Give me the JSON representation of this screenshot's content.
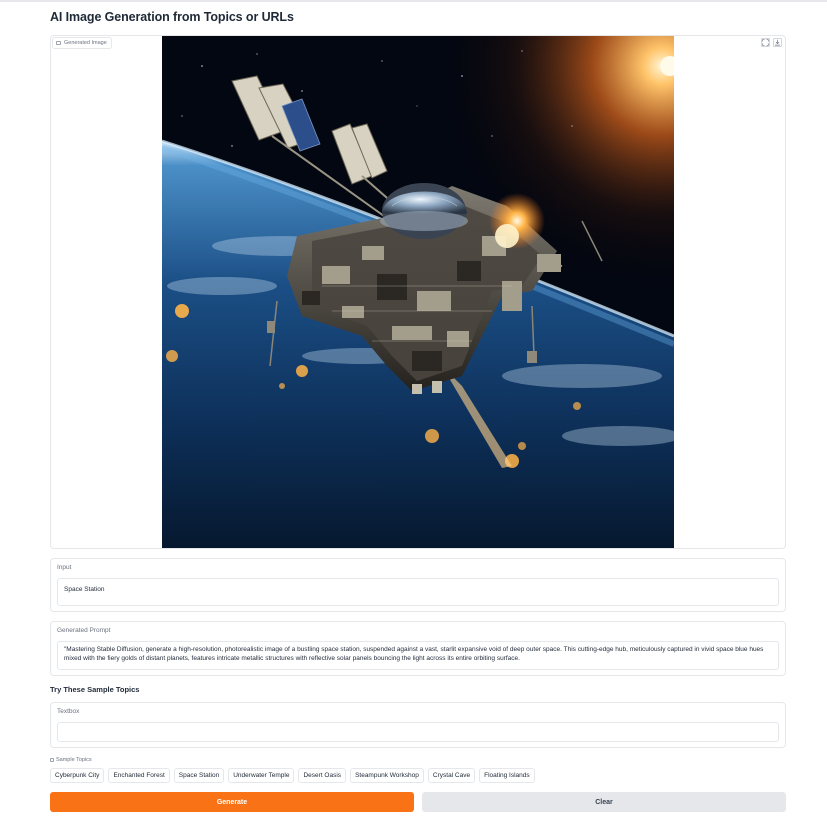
{
  "app": {
    "title": "AI Image Generation from Topics or URLs"
  },
  "image_panel": {
    "label": "Generated Image",
    "tools": [
      "fullscreen-icon",
      "download-icon"
    ]
  },
  "input": {
    "label": "Input",
    "value": "Space Station"
  },
  "generated_prompt": {
    "label": "Generated Prompt",
    "value": "\"Mastering Stable Diffusion, generate a high-resolution, photorealistic image of a bustling space station, suspended against a vast, starlit expansive void of deep outer space. This cutting-edge hub, meticulously captured in vivid space blue hues mixed with the fiery golds of distant planets, features intricate metallic structures with reflective solar panels bouncing the light across its entire orbiting surface."
  },
  "samples": {
    "heading": "Try These Sample Topics",
    "textbox_label": "Textbox",
    "textbox_value": "",
    "dataset_label": "Sample Topics",
    "items": [
      "Cyberpunk City",
      "Enchanted Forest",
      "Space Station",
      "Underwater Temple",
      "Desert Oasis",
      "Steampunk Workshop",
      "Crystal Cave",
      "Floating Islands"
    ]
  },
  "actions": {
    "generate_label": "Generate",
    "clear_label": "Clear"
  },
  "colors": {
    "primary": "#f97316",
    "secondary": "#e5e7eb"
  }
}
